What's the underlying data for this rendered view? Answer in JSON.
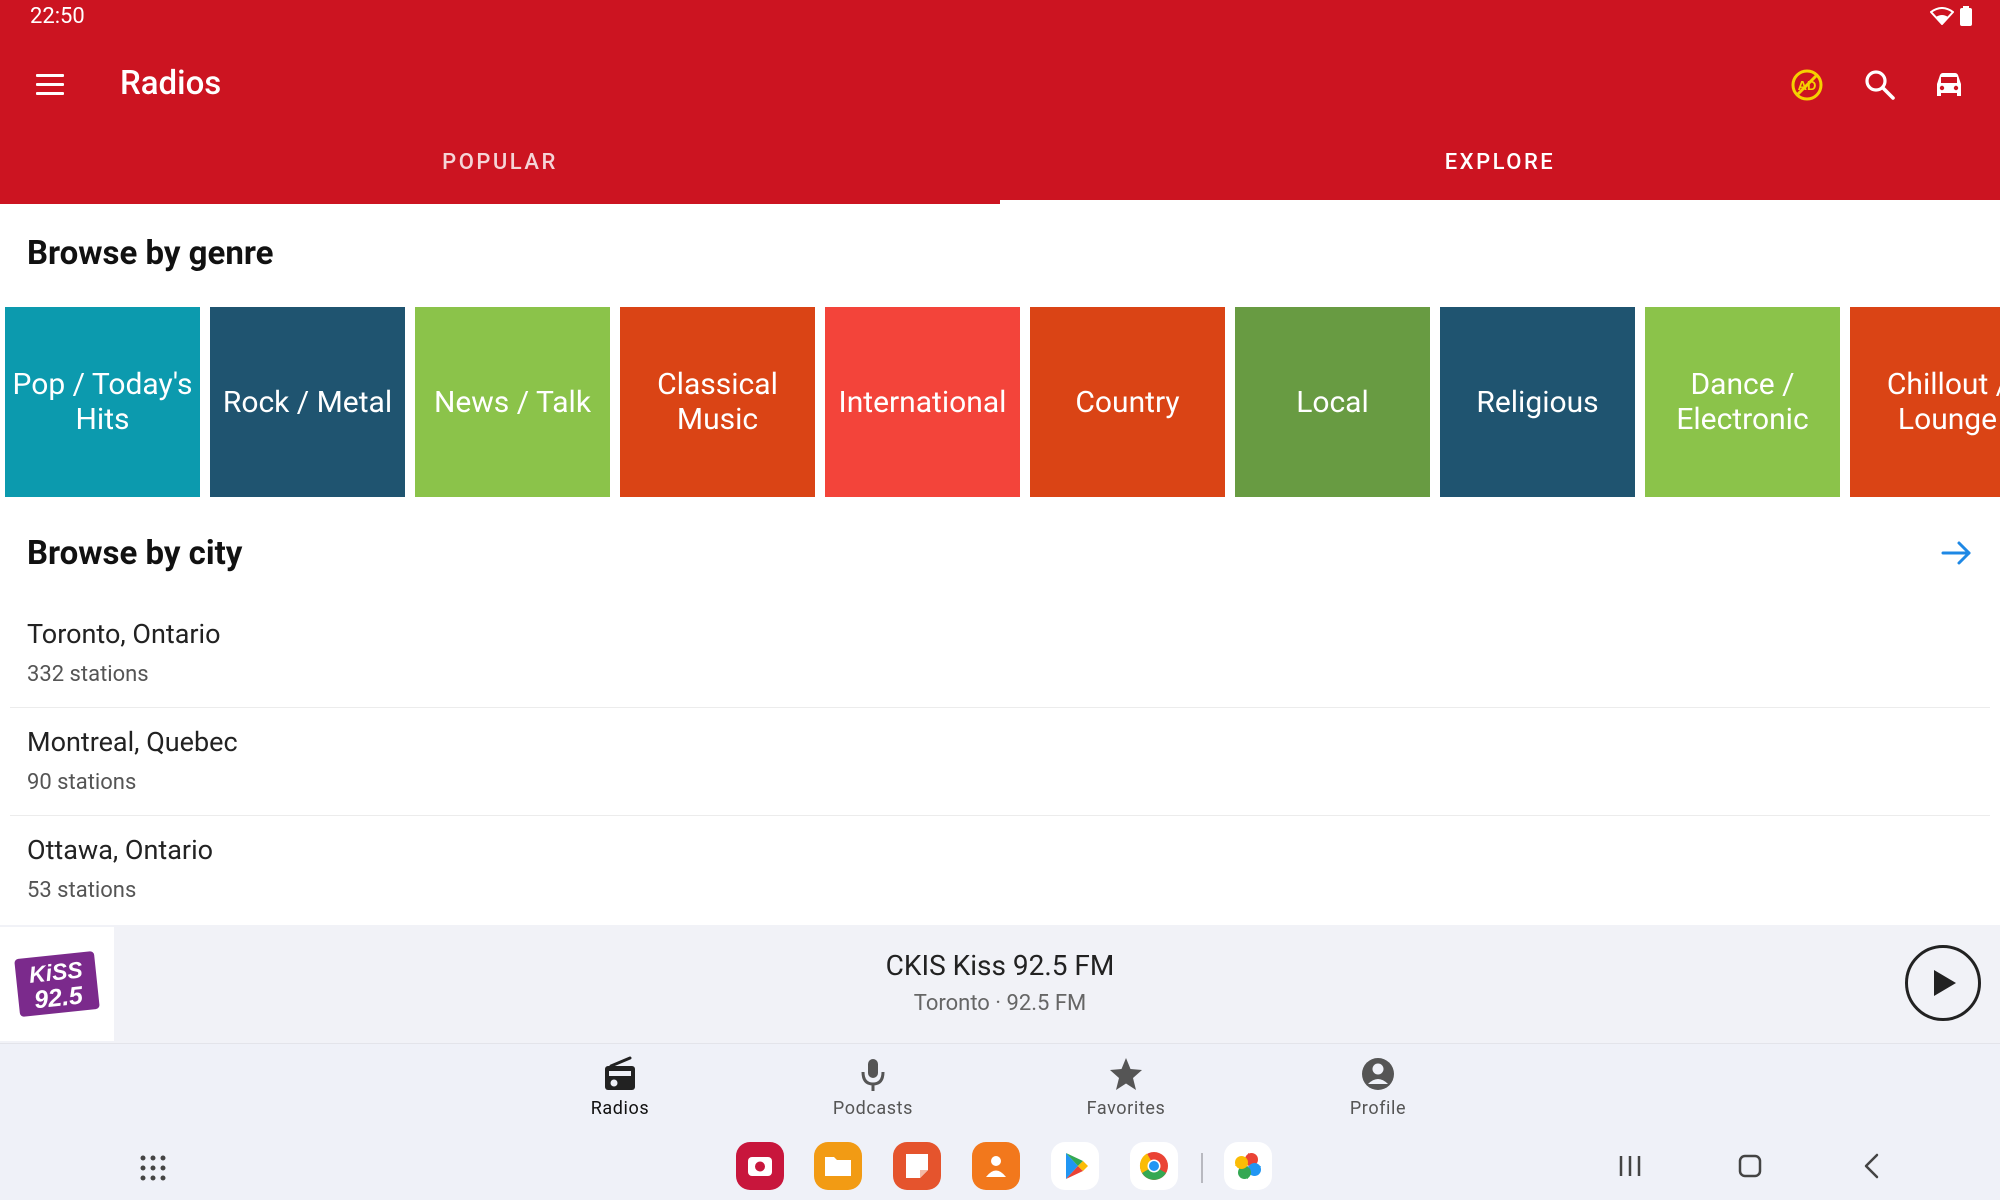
{
  "status": {
    "time": "22:50"
  },
  "app_bar": {
    "title": "Radios"
  },
  "tabs": [
    {
      "label": "POPULAR",
      "selected": false
    },
    {
      "label": "EXPLORE",
      "selected": true
    }
  ],
  "genres": {
    "title": "Browse by genre",
    "items": [
      {
        "label": "Pop / Today's Hits",
        "color": "#0c9aae"
      },
      {
        "label": "Rock / Metal",
        "color": "#1f5470"
      },
      {
        "label": "News / Talk",
        "color": "#8bc34a"
      },
      {
        "label": "Classical Music",
        "color": "#da4415"
      },
      {
        "label": "International",
        "color": "#f3443a"
      },
      {
        "label": "Country",
        "color": "#da4415"
      },
      {
        "label": "Local",
        "color": "#689b42"
      },
      {
        "label": "Religious",
        "color": "#1f5470"
      },
      {
        "label": "Dance / Electronic",
        "color": "#8bc34a"
      },
      {
        "label": "Chillout / Lounge",
        "color": "#da4415"
      }
    ]
  },
  "cities": {
    "title": "Browse by city",
    "items": [
      {
        "name": "Toronto, Ontario",
        "count": "332 stations"
      },
      {
        "name": "Montreal, Quebec",
        "count": "90 stations"
      },
      {
        "name": "Ottawa, Ontario",
        "count": "53 stations"
      }
    ]
  },
  "player": {
    "logo_text_top": "KiSS",
    "logo_text_bottom": "92.5",
    "station": "CKIS Kiss 92.5 FM",
    "subtitle": "Toronto · 92.5 FM"
  },
  "bottom_nav": [
    {
      "label": "Radios",
      "icon": "radio-icon",
      "selected": true
    },
    {
      "label": "Podcasts",
      "icon": "microphone-icon"
    },
    {
      "label": "Favorites",
      "icon": "star-icon"
    },
    {
      "label": "Profile",
      "icon": "account-circle-icon"
    }
  ],
  "colors": {
    "accent": "#cc1421",
    "link": "#1e88e5"
  }
}
